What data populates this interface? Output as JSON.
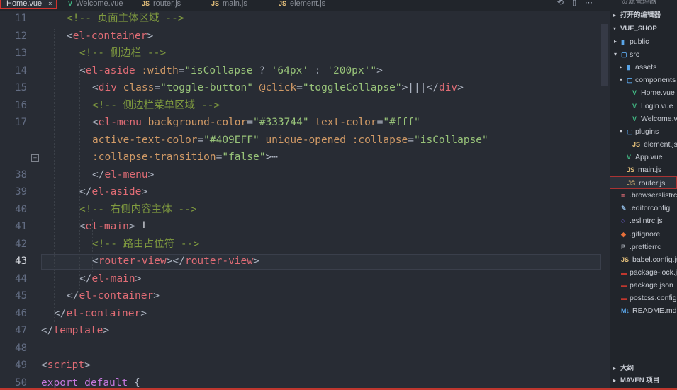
{
  "tabs": [
    {
      "label": "Home.vue",
      "type": "vue",
      "active": true
    },
    {
      "label": "Welcome.vue",
      "type": "vue"
    },
    {
      "label": "router.js",
      "type": "js"
    },
    {
      "label": "main.js",
      "type": "js"
    },
    {
      "label": "element.js",
      "type": "js"
    }
  ],
  "tab_actions": {
    "split": "⟲",
    "layout": "▯",
    "more": "⋯"
  },
  "editor": {
    "current_line": 43,
    "lines": [
      {
        "n": "11",
        "segs": [
          [
            "c-com",
            "<!-- 页面主体区域 -->"
          ]
        ]
      },
      {
        "n": "12",
        "segs": [
          [
            "c-brk",
            "<"
          ],
          [
            "c-tag",
            "el-container"
          ],
          [
            "c-brk",
            ">"
          ]
        ]
      },
      {
        "n": "13",
        "segs": [
          [
            "c-com",
            "<!-- 侧边栏 -->"
          ]
        ]
      },
      {
        "n": "14",
        "segs": [
          [
            "c-brk",
            "<"
          ],
          [
            "c-tag",
            "el-aside"
          ],
          [
            "c-pl",
            " "
          ],
          [
            "c-attr",
            ":width"
          ],
          [
            "c-pl",
            "="
          ],
          [
            "c-str",
            "\"isCollapse"
          ],
          [
            "c-pl",
            " ? "
          ],
          [
            "c-str",
            "'64px'"
          ],
          [
            "c-pl",
            " : "
          ],
          [
            "c-str",
            "'200px'\""
          ],
          [
            "c-brk",
            ">"
          ]
        ]
      },
      {
        "n": "15",
        "segs": [
          [
            "c-brk",
            "<"
          ],
          [
            "c-tag",
            "div"
          ],
          [
            "c-pl",
            " "
          ],
          [
            "c-attr",
            "class"
          ],
          [
            "c-pl",
            "="
          ],
          [
            "c-str",
            "\"toggle-button\""
          ],
          [
            "c-pl",
            " "
          ],
          [
            "c-attr",
            "@click"
          ],
          [
            "c-pl",
            "="
          ],
          [
            "c-str",
            "\"toggleCollapse\""
          ],
          [
            "c-brk",
            ">"
          ],
          [
            "c-pl",
            "|||"
          ],
          [
            "c-brk",
            "</"
          ],
          [
            "c-tag",
            "div"
          ],
          [
            "c-brk",
            ">"
          ]
        ]
      },
      {
        "n": "16",
        "segs": [
          [
            "c-com",
            "<!-- 侧边栏菜单区域 -->"
          ]
        ]
      },
      {
        "n": "17",
        "segs": [
          [
            "c-brk",
            "<"
          ],
          [
            "c-tag",
            "el-menu"
          ],
          [
            "c-pl",
            " "
          ],
          [
            "c-attr",
            "background-color"
          ],
          [
            "c-pl",
            "="
          ],
          [
            "c-str",
            "\"#333744\""
          ],
          [
            "c-pl",
            " "
          ],
          [
            "c-attr",
            "text-color"
          ],
          [
            "c-pl",
            "="
          ],
          [
            "c-str",
            "\"#fff\""
          ]
        ]
      },
      {
        "n": "",
        "segs": [
          [
            "c-attr",
            "active-text-color"
          ],
          [
            "c-pl",
            "="
          ],
          [
            "c-str",
            "\"#409EFF\""
          ],
          [
            "c-pl",
            " "
          ],
          [
            "c-attr",
            "unique-opened"
          ],
          [
            "c-pl",
            " "
          ],
          [
            "c-attr",
            ":collapse"
          ],
          [
            "c-pl",
            "="
          ],
          [
            "c-str",
            "\"isCollapse\""
          ]
        ]
      },
      {
        "n": "",
        "segs": [
          [
            "c-attr",
            ":collapse-transition"
          ],
          [
            "c-pl",
            "="
          ],
          [
            "c-str",
            "\"false\""
          ],
          [
            "c-brk",
            ">"
          ],
          [
            "c-pl",
            "⋯"
          ]
        ]
      },
      {
        "n": "38",
        "segs": [
          [
            "c-brk",
            "</"
          ],
          [
            "c-tag",
            "el-menu"
          ],
          [
            "c-brk",
            ">"
          ]
        ]
      },
      {
        "n": "39",
        "segs": [
          [
            "c-brk",
            "</"
          ],
          [
            "c-tag",
            "el-aside"
          ],
          [
            "c-brk",
            ">"
          ]
        ]
      },
      {
        "n": "40",
        "segs": [
          [
            "c-com",
            "<!-- 右侧内容主体 -->"
          ]
        ]
      },
      {
        "n": "41",
        "segs": [
          [
            "c-brk",
            "<"
          ],
          [
            "c-tag",
            "el-main"
          ],
          [
            "c-brk",
            ">"
          ]
        ]
      },
      {
        "n": "42",
        "segs": [
          [
            "c-com",
            "<!-- 路由占位符 -->"
          ]
        ]
      },
      {
        "n": "43",
        "segs": [
          [
            "c-brk",
            "<"
          ],
          [
            "c-tag",
            "router-view"
          ],
          [
            "c-brk",
            "></"
          ],
          [
            "c-tag",
            "router-view"
          ],
          [
            "c-brk",
            ">"
          ]
        ]
      },
      {
        "n": "44",
        "segs": [
          [
            "c-brk",
            "</"
          ],
          [
            "c-tag",
            "el-main"
          ],
          [
            "c-brk",
            ">"
          ]
        ]
      },
      {
        "n": "45",
        "segs": [
          [
            "c-brk",
            "</"
          ],
          [
            "c-tag",
            "el-container"
          ],
          [
            "c-brk",
            ">"
          ]
        ]
      },
      {
        "n": "46",
        "segs": [
          [
            "c-brk",
            "</"
          ],
          [
            "c-tag",
            "el-container"
          ],
          [
            "c-brk",
            ">"
          ]
        ]
      },
      {
        "n": "47",
        "segs": [
          [
            "c-brk",
            "</"
          ],
          [
            "c-tag",
            "template"
          ],
          [
            "c-brk",
            ">"
          ]
        ]
      },
      {
        "n": "48",
        "segs": []
      },
      {
        "n": "49",
        "segs": [
          [
            "c-brk",
            "<"
          ],
          [
            "c-tag",
            "script"
          ],
          [
            "c-brk",
            ">"
          ]
        ]
      },
      {
        "n": "50",
        "segs": [
          [
            "c-kw",
            "export"
          ],
          [
            "c-pl",
            " "
          ],
          [
            "c-kw",
            "default"
          ],
          [
            "c-pl",
            " {"
          ]
        ]
      }
    ]
  },
  "explorer": {
    "title": "资源管理器",
    "open_editors": "打开的编辑器",
    "project": "VUE_SHOP",
    "items": [
      {
        "label": "public",
        "kind": "folder",
        "icon": "▮",
        "color": "#5aa5e8"
      },
      {
        "label": "src",
        "kind": "folder-open",
        "icon": "▢",
        "color": "#5aa5e8"
      },
      {
        "label": "assets",
        "kind": "folder",
        "icon": "▮",
        "color": "#5aa5e8"
      },
      {
        "label": "components",
        "kind": "folder-open",
        "icon": "▢",
        "color": "#5aa5e8"
      },
      {
        "label": "Home.vue",
        "kind": "file",
        "icon": "V",
        "color": "#41b883"
      },
      {
        "label": "Login.vue",
        "kind": "file",
        "icon": "V",
        "color": "#41b883"
      },
      {
        "label": "Welcome.vue",
        "kind": "file",
        "icon": "V",
        "color": "#41b883"
      },
      {
        "label": "plugins",
        "kind": "folder-open",
        "icon": "▢",
        "color": "#5aa5e8"
      },
      {
        "label": "element.js",
        "kind": "file",
        "icon": "JS",
        "color": "#e5c07b"
      },
      {
        "label": "App.vue",
        "kind": "file",
        "icon": "V",
        "color": "#41b883"
      },
      {
        "label": "main.js",
        "kind": "file",
        "icon": "JS",
        "color": "#e5c07b"
      },
      {
        "label": "router.js",
        "kind": "file",
        "icon": "JS",
        "color": "#e5c07b",
        "selected": true
      },
      {
        "label": ".browserslistrc",
        "kind": "file",
        "icon": "≡",
        "color": "#e06c75"
      },
      {
        "label": ".editorconfig",
        "kind": "file",
        "icon": "✎",
        "color": "#8fb9e0"
      },
      {
        "label": ".eslintrc.js",
        "kind": "file",
        "icon": "○",
        "color": "#7b6cf0"
      },
      {
        "label": ".gitignore",
        "kind": "file",
        "icon": "◆",
        "color": "#e8703a"
      },
      {
        "label": ".prettierrc",
        "kind": "file",
        "icon": "P",
        "color": "#9aa0a8"
      },
      {
        "label": "babel.config.js",
        "kind": "file",
        "icon": "JS",
        "color": "#e5c07b"
      },
      {
        "label": "package-lock.json",
        "kind": "file",
        "icon": "▬",
        "color": "#c0372e"
      },
      {
        "label": "package.json",
        "kind": "file",
        "icon": "▬",
        "color": "#c0372e"
      },
      {
        "label": "postcss.config.js",
        "kind": "file",
        "icon": "▬",
        "color": "#c0372e"
      },
      {
        "label": "README.md",
        "kind": "file",
        "icon": "M↓",
        "color": "#5aa5e8"
      }
    ],
    "outline": "大纲",
    "maven": "MAVEN 项目"
  }
}
